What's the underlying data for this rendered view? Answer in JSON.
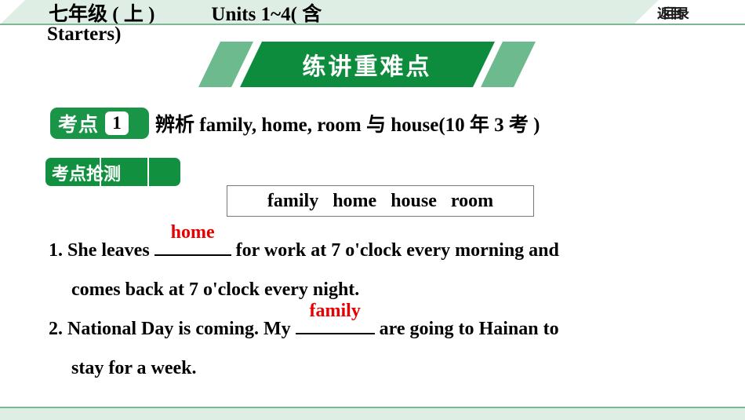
{
  "header": {
    "grade_title": "七年级 ( 上 )",
    "units_title": "Units 1~4( 含",
    "units_title_line2": "Starters)",
    "return_label": "返回目录"
  },
  "banner": {
    "title": "练讲重难点"
  },
  "section": {
    "badge_label": "考点",
    "badge_number": "1",
    "title": "辨析 family, home, room 与 house(10 年 3 考 )"
  },
  "subsection": {
    "tab_label": "考点抢测"
  },
  "word_bank": {
    "words": "family   home   house   room"
  },
  "questions": [
    {
      "number": "1.",
      "pre_text": "She leaves ",
      "answer": "home",
      "post_text": " for work at 7 o'clock every morning and",
      "line2": "comes back at 7 o'clock every night."
    },
    {
      "number": "2.",
      "pre_text": "National Day is coming. My ",
      "answer": "family",
      "post_text": " are going to Hainan to",
      "line2": "stay for a week."
    }
  ],
  "colors": {
    "brand_green": "#0e8c3e",
    "light_green": "#6cba8d",
    "pale_green": "#dfeee4",
    "answer_red": "#e80000"
  }
}
